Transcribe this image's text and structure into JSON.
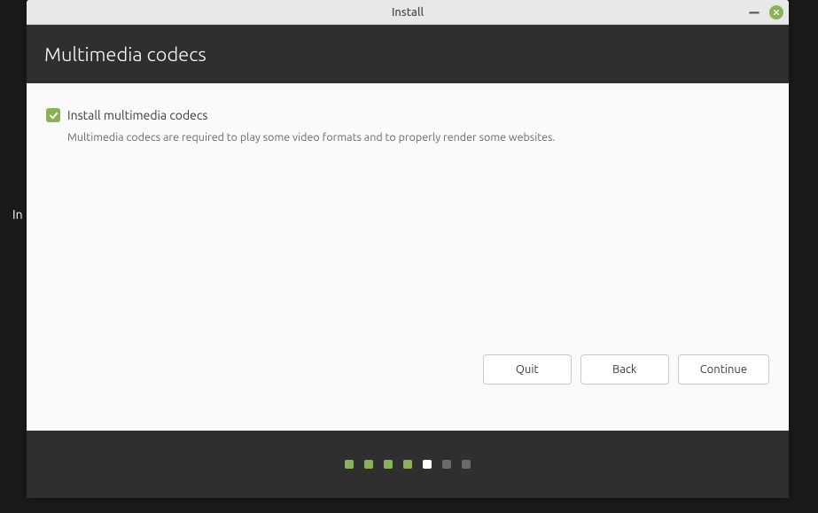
{
  "window": {
    "title": "Install"
  },
  "header": {
    "title": "Multimedia codecs"
  },
  "content": {
    "checkbox_label": "Install multimedia codecs",
    "checkbox_checked": true,
    "description": "Multimedia codecs are required to play some video formats and to properly render some websites."
  },
  "buttons": {
    "quit": "Quit",
    "back": "Back",
    "continue": "Continue"
  },
  "progress": {
    "total": 7,
    "current": 5,
    "states": [
      "done",
      "done",
      "done",
      "done",
      "current",
      "future",
      "future"
    ]
  },
  "background": {
    "partial_text": "In"
  },
  "colors": {
    "accent": "#8bb158",
    "header_bg": "#2f2f2f"
  }
}
